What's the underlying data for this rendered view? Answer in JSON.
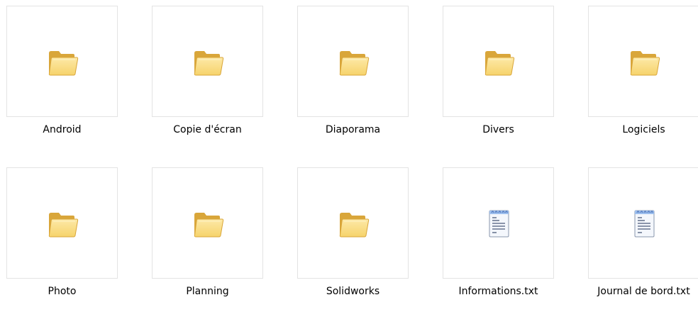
{
  "window": {
    "view": "thumbnails"
  },
  "items": [
    {
      "name": "Android",
      "type": "folder",
      "icon": "folder-icon"
    },
    {
      "name": "Copie d'écran",
      "type": "folder",
      "icon": "folder-icon"
    },
    {
      "name": "Diaporama",
      "type": "folder",
      "icon": "folder-icon"
    },
    {
      "name": "Divers",
      "type": "folder",
      "icon": "folder-icon"
    },
    {
      "name": "Logiciels",
      "type": "folder",
      "icon": "folder-icon"
    },
    {
      "name": "Photo",
      "type": "folder",
      "icon": "folder-icon"
    },
    {
      "name": "Planning",
      "type": "folder",
      "icon": "folder-icon"
    },
    {
      "name": "Solidworks",
      "type": "folder",
      "icon": "folder-icon"
    },
    {
      "name": "Informations.txt",
      "type": "text-file",
      "icon": "text-file-icon"
    },
    {
      "name": "Journal de bord.txt",
      "type": "text-file",
      "icon": "text-file-icon"
    }
  ],
  "colors": {
    "thumb_border": "#e3e3e3",
    "folder_body": "#f6d36b",
    "folder_dark": "#d9a63a",
    "folder_light": "#fde9a8",
    "notepad_ring": "#5a7fc0",
    "notepad_lines": "#4b5a78"
  }
}
